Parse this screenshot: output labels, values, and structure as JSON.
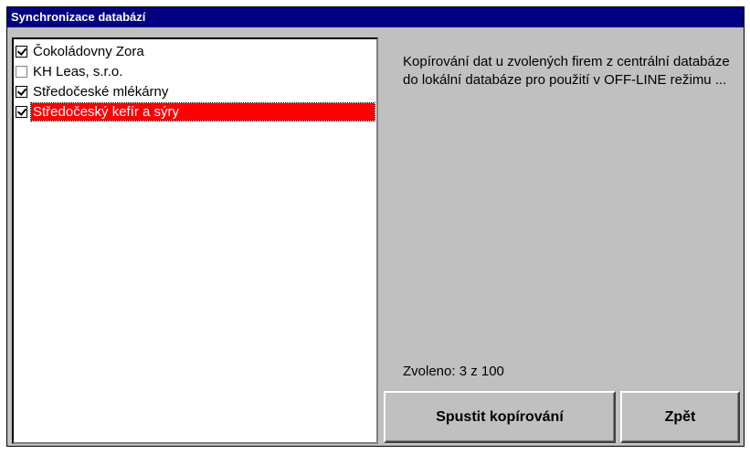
{
  "window": {
    "title": "Synchronizace databází"
  },
  "companies": [
    {
      "label": "Čokoládovny Zora",
      "checked": true,
      "selected": false
    },
    {
      "label": "KH Leas, s.r.o.",
      "checked": false,
      "selected": false
    },
    {
      "label": "Středočeské mlékárny",
      "checked": true,
      "selected": false
    },
    {
      "label": "Středočeský kefír a sýry",
      "checked": true,
      "selected": true
    }
  ],
  "description": "Kopírování dat u zvolených firem z centrální databáze do lokální databáze pro použití v OFF-LINE režimu ...",
  "status": {
    "text": "Zvoleno:  3 z 100"
  },
  "buttons": {
    "start_label": "Spustit kopírování",
    "back_label": "Zpět"
  },
  "colors": {
    "titlebar": "#000080",
    "selection": "#ff0000",
    "window_bg": "#c0c0c0"
  }
}
